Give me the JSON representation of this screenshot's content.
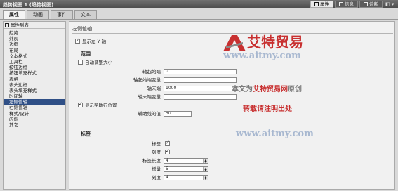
{
  "window": {
    "title": "趋势视图 1 (趋势视图)",
    "right_tabs": [
      {
        "label": "属性",
        "icon": "properties-icon"
      },
      {
        "label": "信息",
        "icon": "info-icon"
      },
      {
        "label": "诊断",
        "icon": "diagnostics-icon"
      }
    ],
    "controls": "◧ ▾"
  },
  "tabs": [
    "属性",
    "动画",
    "事件",
    "文本"
  ],
  "left_panel": {
    "header": "属性列表",
    "items": [
      "趋势",
      "外观",
      "边框",
      "布局",
      "文本格式",
      "工具栏",
      "按钮边框",
      "按钮填充样式",
      "表格",
      "表头边框",
      "表头填充样式",
      "时间轴",
      "左侧值轴",
      "右侧值轴",
      "样式/设计",
      "闪烁",
      "其它"
    ],
    "selected_index": 12
  },
  "panel": {
    "heading": "左侧值轴",
    "show_axis_label": "显示左 Y 轴",
    "show_axis_checked": true,
    "range": {
      "heading": "范围",
      "auto_scale_label": "自动调整大小",
      "auto_scale_checked": false,
      "fields": [
        {
          "label": "轴起始端",
          "value": "0"
        },
        {
          "label": "轴起始端变量",
          "value": ""
        },
        {
          "label": "轴末端",
          "value": "1000"
        },
        {
          "label": "轴末端变量",
          "value": ""
        }
      ],
      "helpline_label": "显示帮助行位置",
      "helpline_checked": true,
      "helpline_value_label": "辅助线的值",
      "helpline_value": "50"
    },
    "labels": {
      "heading": "标签",
      "rows": [
        {
          "label": "标签",
          "kind": "check",
          "checked": true
        },
        {
          "label": "刻度",
          "kind": "check",
          "checked": true
        },
        {
          "label": "标签长度",
          "kind": "spin",
          "value": "4"
        },
        {
          "label": "增量",
          "kind": "spin",
          "value": "5"
        },
        {
          "label": "刻度",
          "kind": "spin",
          "value": "4"
        }
      ]
    }
  },
  "watermark": {
    "title": "艾特贸易",
    "url": "www.aitmy.com",
    "line1_prefix": "本文为",
    "line1_brand": "艾特贸易网",
    "line1_suffix": "原创",
    "line2": "转载请注明出处",
    "url2": "www.aitmy.com",
    "colors": {
      "red": "#c83030",
      "gray": "#8a8a8a",
      "blue": "#a8b8d0"
    }
  }
}
